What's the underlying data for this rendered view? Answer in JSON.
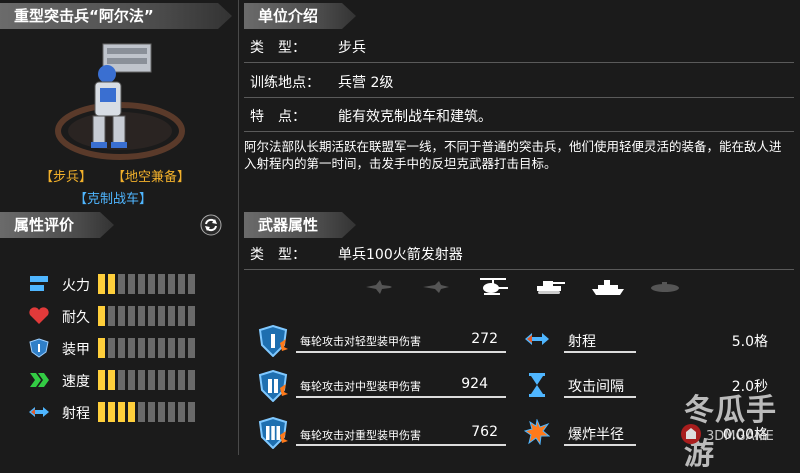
{
  "unit": {
    "title": "重型突击兵“阿尔法”",
    "tags": [
      "【步兵】",
      "【地空兼备】"
    ],
    "counter_tag": "【克制战车】"
  },
  "ratings": {
    "header": "属性评价",
    "stats": [
      {
        "label": "火力",
        "icon": "firepower-icon",
        "level": 2,
        "max": 10
      },
      {
        "label": "耐久",
        "icon": "heart-icon",
        "level": 1,
        "max": 10
      },
      {
        "label": "装甲",
        "icon": "armor-shield-icon",
        "level": 1,
        "max": 10
      },
      {
        "label": "速度",
        "icon": "speed-chevron-icon",
        "level": 2,
        "max": 10
      },
      {
        "label": "射程",
        "icon": "range-arrows-icon",
        "level": 4,
        "max": 10
      }
    ]
  },
  "intro": {
    "header": "单位介绍",
    "type_label": "类　型：",
    "type_value": "步兵",
    "train_label": "训练地点：",
    "train_value": "兵营 2级",
    "feature_label": "特　点：",
    "feature_value": "能有效克制战车和建筑。",
    "description": "阿尔法部队长期活跃在联盟军一线，不同于普通的突击兵，他们使用轻便灵活的装备，能在敌人进入射程内的第一时间，击发手中的反坦克武器打击目标。"
  },
  "weapon": {
    "header": "武器属性",
    "type_label": "类　型：",
    "type_value": "单兵100火箭发射器",
    "targets": [
      "fighter-jet-icon",
      "bomber-icon",
      "helicopter-icon",
      "tank-icon",
      "ship-icon",
      "submarine-icon"
    ],
    "damage_rows": [
      {
        "label": "每轮攻击对轻型装甲伤害",
        "value": "272",
        "icon": "armor-1-icon"
      },
      {
        "label": "每轮攻击对中型装甲伤害",
        "value": "924",
        "icon": "armor-2-icon"
      },
      {
        "label": "每轮攻击对重型装甲伤害",
        "value": "762",
        "icon": "armor-3-icon"
      }
    ],
    "prop_rows": [
      {
        "label": "射程",
        "value": "5.0格",
        "icon": "range-icon"
      },
      {
        "label": "攻击间隔",
        "value": "2.0秒",
        "icon": "hourglass-icon"
      },
      {
        "label": "爆炸半径",
        "value": "0.00格",
        "icon": "explosion-icon"
      }
    ]
  },
  "watermark": {
    "text": "冬瓜手游",
    "sub": "3DMGAME"
  }
}
